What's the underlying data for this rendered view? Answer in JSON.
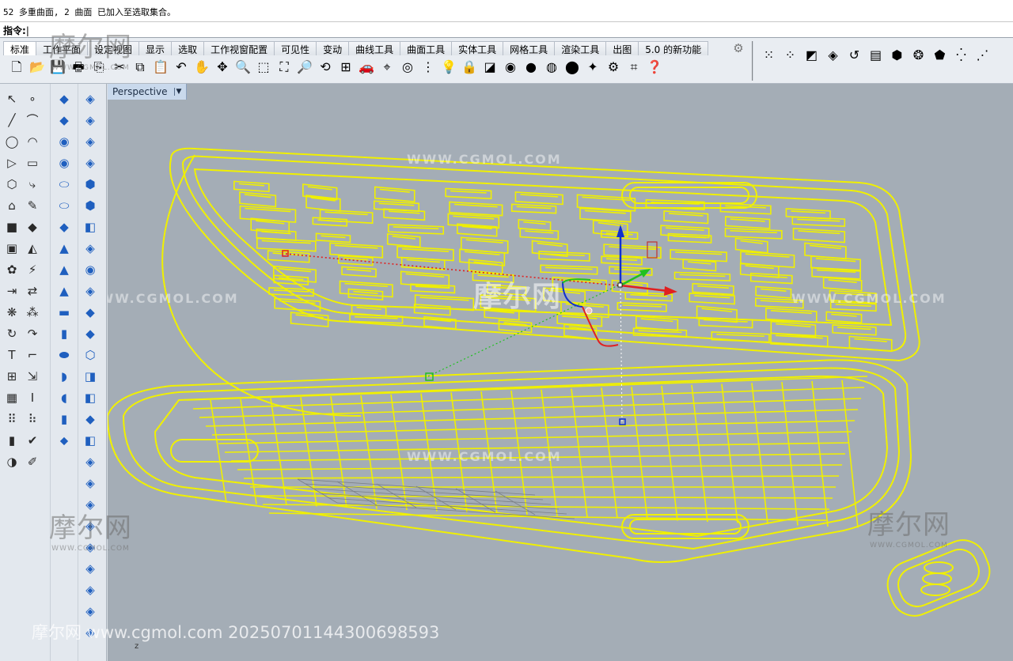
{
  "command": {
    "history": "52 多重曲面, 2 曲面 已加入至选取集合。",
    "prompt": "指令:"
  },
  "tabs": [
    {
      "label": "标准"
    },
    {
      "label": "工作平面"
    },
    {
      "label": "设定视图"
    },
    {
      "label": "显示"
    },
    {
      "label": "选取"
    },
    {
      "label": "工作视窗配置"
    },
    {
      "label": "可见性"
    },
    {
      "label": "变动"
    },
    {
      "label": "曲线工具"
    },
    {
      "label": "曲面工具"
    },
    {
      "label": "实体工具"
    },
    {
      "label": "网格工具"
    },
    {
      "label": "渲染工具"
    },
    {
      "label": "出图"
    },
    {
      "label": "5.0 的新功能"
    }
  ],
  "std_toolbar_icons": [
    {
      "name": "new-file-icon",
      "glyph": "🗋"
    },
    {
      "name": "open-folder-icon",
      "glyph": "📂"
    },
    {
      "name": "save-icon",
      "glyph": "💾"
    },
    {
      "name": "print-icon",
      "glyph": "🖶"
    },
    {
      "name": "import-icon",
      "glyph": "⎘"
    },
    {
      "name": "cut-icon",
      "glyph": "✂"
    },
    {
      "name": "copy-icon",
      "glyph": "⧉"
    },
    {
      "name": "paste-icon",
      "glyph": "📋"
    },
    {
      "name": "undo-icon",
      "glyph": "↶"
    },
    {
      "name": "pan-hand-icon",
      "glyph": "✋"
    },
    {
      "name": "move-view-icon",
      "glyph": "✥"
    },
    {
      "name": "zoom-icon",
      "glyph": "🔍"
    },
    {
      "name": "zoom-window-icon",
      "glyph": "⬚"
    },
    {
      "name": "zoom-extents-icon",
      "glyph": "⛶"
    },
    {
      "name": "zoom-selected-icon",
      "glyph": "🔎"
    },
    {
      "name": "rotate-view-icon",
      "glyph": "⟲"
    },
    {
      "name": "four-views-icon",
      "glyph": "⊞"
    },
    {
      "name": "car-icon",
      "glyph": "🚗"
    },
    {
      "name": "grid-snap-icon",
      "glyph": "⌖"
    },
    {
      "name": "target-icon",
      "glyph": "◎"
    },
    {
      "name": "select-points-icon",
      "glyph": "⋮"
    },
    {
      "name": "light-bulb-icon",
      "glyph": "💡"
    },
    {
      "name": "lock-icon",
      "glyph": "🔒"
    },
    {
      "name": "layer-icon",
      "glyph": "◪"
    },
    {
      "name": "color-wheel-icon",
      "glyph": "◉"
    },
    {
      "name": "shaded-sphere-icon",
      "glyph": "●"
    },
    {
      "name": "render-sphere-icon",
      "glyph": "◍"
    },
    {
      "name": "blue-sphere-icon",
      "glyph": "⬤"
    },
    {
      "name": "gumball-icon",
      "glyph": "✦"
    },
    {
      "name": "gear-options-icon",
      "glyph": "⚙"
    },
    {
      "name": "properties-icon",
      "glyph": "⌗"
    },
    {
      "name": "help-icon",
      "glyph": "❓"
    }
  ],
  "right_toolbar_icons": [
    {
      "name": "point-cloud-icon",
      "glyph": "⁙"
    },
    {
      "name": "points-off-icon",
      "glyph": "⁘"
    },
    {
      "name": "black-white-icon",
      "glyph": "◩"
    },
    {
      "name": "box-gold-icon",
      "glyph": "◈"
    },
    {
      "name": "curve-arrow-icon",
      "glyph": "↺"
    },
    {
      "name": "text-block-icon",
      "glyph": "▤"
    },
    {
      "name": "gem-icon",
      "glyph": "⬢"
    },
    {
      "name": "color-balls-icon",
      "glyph": "❂"
    },
    {
      "name": "tag-icon",
      "glyph": "⬟"
    },
    {
      "name": "dots-icon",
      "glyph": "⁛"
    },
    {
      "name": "dot-grid-icon",
      "glyph": "⋰"
    }
  ],
  "left_col1": [
    "↖",
    "∘",
    "╱",
    "⌒",
    "◯",
    "◠",
    "▷",
    "▭",
    "⬡",
    "⤷",
    "⌂",
    "✎",
    "■",
    "◆",
    "▣",
    "◭",
    "✿",
    "⚡",
    "⇥",
    "⇄",
    "❋",
    "⁂",
    "↻",
    "↷",
    "T",
    "⌐",
    "⊞",
    "⇲",
    "▦",
    "I",
    "⠿",
    "⠷",
    "▮",
    "✔",
    "◑",
    "✐"
  ],
  "left_col2": [
    "◆",
    "◆",
    "◉",
    "◉",
    "⬭",
    "⬭",
    "◆",
    "▲",
    "▲",
    "▲",
    "▬",
    "▮",
    "⬬",
    "◗",
    "◖",
    "▮",
    "⬥"
  ],
  "left_col3": [
    "◈",
    "◈",
    "◈",
    "◈",
    "⬢",
    "⬢",
    "◧",
    "◈",
    "◉",
    "◈",
    "◆",
    "◆",
    "⬡",
    "◨",
    "◧",
    "◆",
    "◧",
    "◈",
    "◈",
    "◈",
    "◈",
    "◈",
    "◈",
    "◈",
    "◈",
    "◈"
  ],
  "viewport": {
    "title": "Perspective",
    "watermark_big": "摩尔网",
    "watermark_url": "WWW.CGMOL.COM",
    "corner_sub": "WWW.CGMOL.COM",
    "footer": "摩尔网 www.cgmol.com 20250701144300698593",
    "axis_label": "z"
  },
  "colors": {
    "wire": "#f0f000",
    "viewport_bg": "#a4adb6",
    "axis_x": "#e02020",
    "axis_y": "#20c020",
    "axis_z": "#1030d0"
  }
}
